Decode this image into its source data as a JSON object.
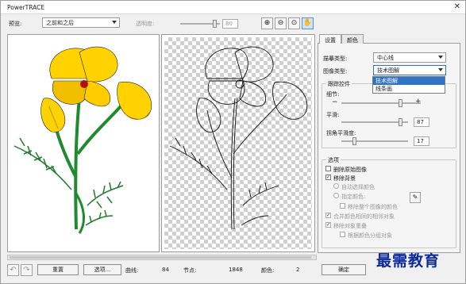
{
  "window": {
    "title": "PowerTRACE",
    "close_glyph": "✕"
  },
  "toolbar": {
    "preview_label": "预览:",
    "preview_value": "之前和之后",
    "transparency_label": "透明度:",
    "transparency_value": "80",
    "zoom_in_icon": "⊕",
    "zoom_out_icon": "⊖",
    "zoom_fit_icon": "⊙",
    "pan_icon": "✋"
  },
  "tabs": {
    "settings": "设置",
    "colors": "颜色"
  },
  "settings": {
    "trace_type_label": "描摹类型:",
    "trace_type_value": "中心线",
    "image_type_label": "图像类型:",
    "image_type_value": "技术图解",
    "image_type_options": [
      "技术图解",
      "线条画"
    ],
    "trace_controls_title": "跟踪控件",
    "detail_label": "细节:",
    "detail_minus": "−",
    "detail_plus": "+",
    "smoothing_label": "平滑:",
    "smoothing_value": "87",
    "corner_label": "拐角平滑度:",
    "corner_value": "17",
    "options_title": "选项",
    "delete_original_label": "删除原始图像",
    "remove_background_label": "移除背景",
    "auto_select_color_label": "自动选择颜色",
    "specify_color_label": "指定颜色:",
    "remove_whole_image_color_label": "移除整个图像的颜色",
    "merge_adjacent_label": "合并颜色相同的相邻对象",
    "remove_overlap_label": "移除对象重叠",
    "group_by_color_label": "根据颜色分组对象"
  },
  "status": {
    "reset_label": "重置",
    "options_label": "选项...",
    "curves_label": "曲线:",
    "curves_value": "84",
    "nodes_label": "节点:",
    "nodes_value": "1848",
    "colors_label": "颜色:",
    "colors_value": "2",
    "ok_label": "确定",
    "undo_icon": "↶",
    "redo_icon": "↷"
  },
  "watermark": "最需教育",
  "colors": {
    "petal": "#ffd200",
    "petal_dark": "#e9a800",
    "center": "#b01010",
    "stem": "#1f8a2e",
    "accent": "#3072c8"
  }
}
